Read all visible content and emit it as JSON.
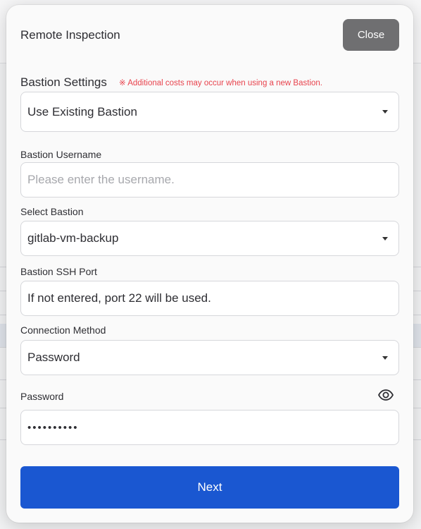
{
  "modal": {
    "title": "Remote Inspection",
    "close_label": "Close",
    "bastion_settings_label": "Bastion Settings",
    "cost_note": "※ Additional costs may occur when using a new Bastion.",
    "bastion_mode_value": "Use Existing Bastion",
    "username": {
      "label": "Bastion Username",
      "placeholder": "Please enter the username.",
      "value": ""
    },
    "select_bastion": {
      "label": "Select Bastion",
      "value": "gitlab-vm-backup"
    },
    "ssh_port": {
      "label": "Bastion SSH Port",
      "placeholder": "If not entered, port 22 will be used.",
      "value": ""
    },
    "connection_method": {
      "label": "Connection Method",
      "value": "Password"
    },
    "password": {
      "label": "Password",
      "masked_value": "••••••••••",
      "toggle_icon": "eye-icon"
    },
    "next_label": "Next"
  },
  "colors": {
    "primary": "#1a57d1",
    "close_button": "#6f6f71",
    "warning_text": "#e8434d"
  }
}
